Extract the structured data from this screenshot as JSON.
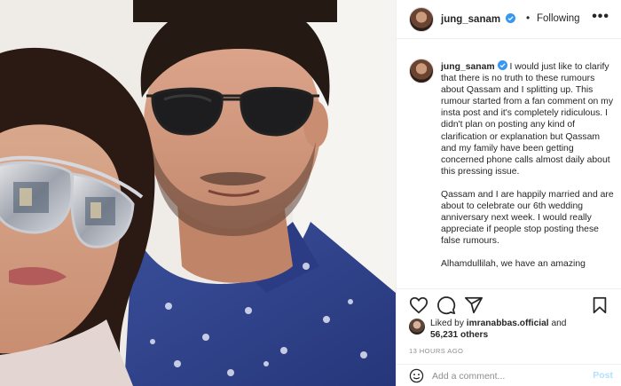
{
  "post": {
    "photo_alt": "",
    "author": {
      "username": "jung_sanam",
      "verified": true,
      "follow_separator": "•",
      "follow_status": "Following"
    },
    "more_label": "•••",
    "caption": {
      "username": "jung_sanam",
      "paragraphs": [
        "I would just like to clarify that there is no truth to these rumours about Qassam and I splitting up. This rumour started from a fan comment on my insta post and it's completely ridiculous. I didn't plan on posting any kind of clarification or explanation but Qassam and my family have been getting concerned phone calls almost daily about this pressing issue.",
        "Qassam and I are happily married and are about to celebrate our 6th wedding anniversary next week. I would really appreciate if people stop posting these false rumours.",
        "Alhamdullilah, we have an amazing"
      ]
    },
    "actions": {
      "like_icon": "heart-icon",
      "comment_icon": "comment-icon",
      "share_icon": "share-icon",
      "save_icon": "bookmark-icon"
    },
    "likes": {
      "prefix": "Liked by ",
      "liker": "imranabbas.official",
      "connector": " and",
      "count": "56,231 others"
    },
    "timestamp": "13 HOURS AGO",
    "comment": {
      "placeholder": "Add a comment...",
      "post_label": "Post",
      "emoji_icon": "emoji-icon"
    },
    "colors": {
      "verified_blue": "#3897f0",
      "post_disabled": "#b2dffc",
      "muted_text": "#8e8e8e",
      "border": "#efefef"
    }
  }
}
